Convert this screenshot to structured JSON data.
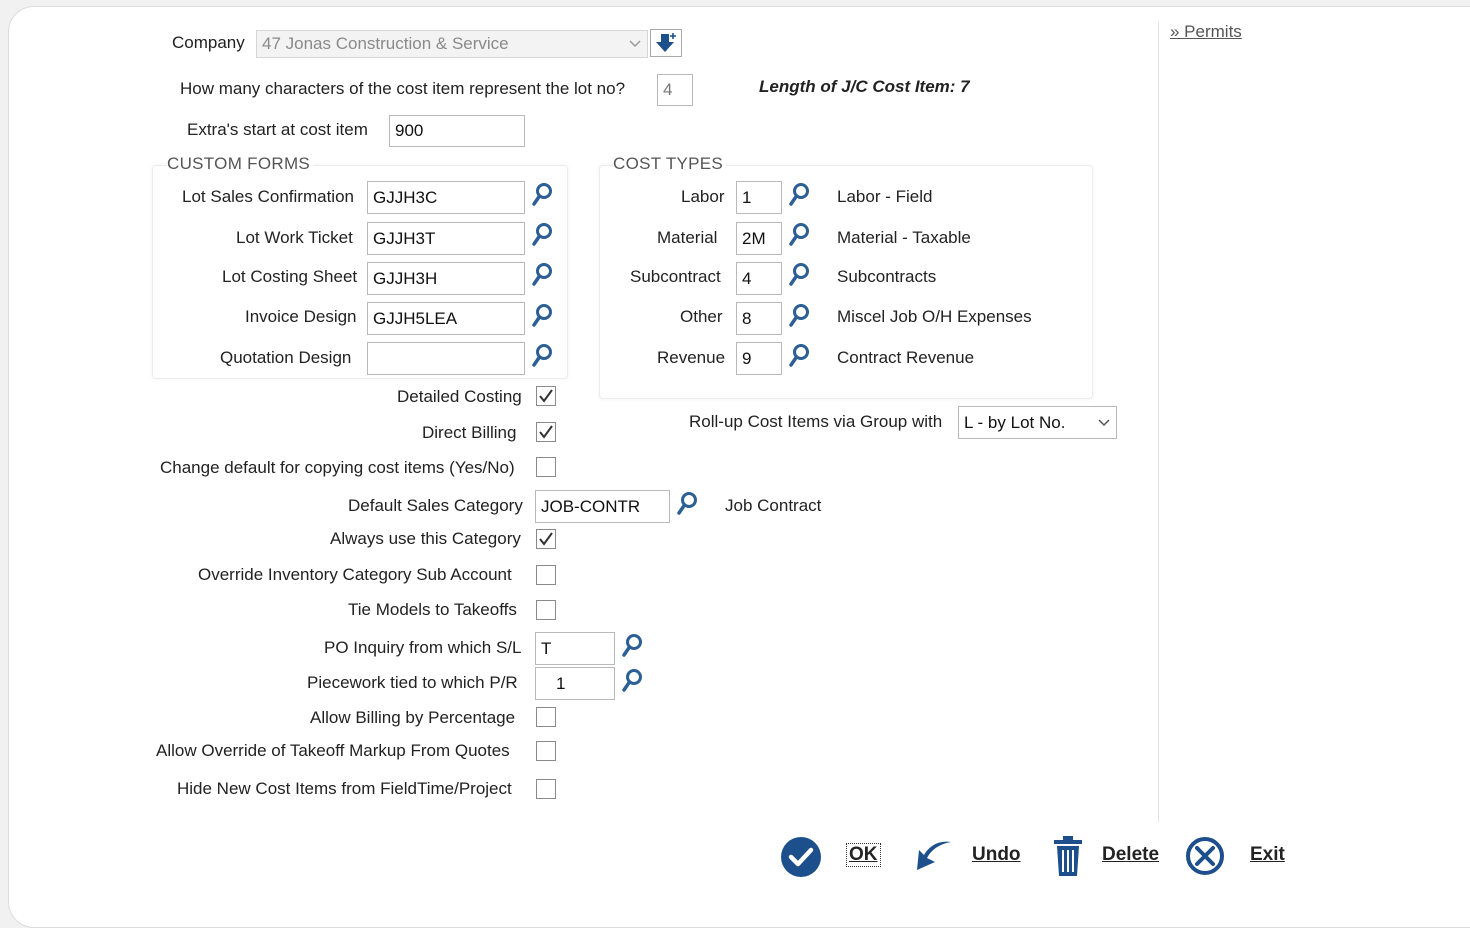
{
  "company": {
    "label": "Company",
    "value": "47 Jonas Construction & Service"
  },
  "lot_chars": {
    "label": "How many characters of the cost item represent the lot no?",
    "value": "4"
  },
  "length_note": "Length of J/C Cost Item: 7",
  "extras": {
    "label": "Extra's start at cost item",
    "value": "900"
  },
  "side_link": "» Permits",
  "custom_forms": {
    "title": "CUSTOM FORMS",
    "rows": [
      {
        "label": "Lot Sales Confirmation",
        "value": "GJJH3C"
      },
      {
        "label": "Lot Work Ticket",
        "value": "GJJH3T"
      },
      {
        "label": "Lot Costing Sheet",
        "value": "GJJH3H"
      },
      {
        "label": "Invoice Design",
        "value": "GJJH5LEA"
      },
      {
        "label": "Quotation Design",
        "value": ""
      }
    ]
  },
  "cost_types": {
    "title": "COST TYPES",
    "rows": [
      {
        "label": "Labor",
        "code": "1",
        "desc": "Labor - Field"
      },
      {
        "label": "Material",
        "code": "2M",
        "desc": "Material - Taxable"
      },
      {
        "label": "Subcontract",
        "code": "4",
        "desc": "Subcontracts"
      },
      {
        "label": "Other",
        "code": "8",
        "desc": "Miscel Job O/H Expenses"
      },
      {
        "label": "Revenue",
        "code": "9",
        "desc": "Contract Revenue"
      }
    ]
  },
  "rollup": {
    "label": "Roll-up Cost Items via Group with",
    "value": "L - by Lot No."
  },
  "checks": {
    "detailed_costing": {
      "label": "Detailed Costing",
      "checked": true
    },
    "direct_billing": {
      "label": "Direct Billing",
      "checked": true
    },
    "change_default": {
      "label": "Change default for copying cost items (Yes/No)",
      "checked": false
    },
    "always_use": {
      "label": "Always use this Category",
      "checked": true
    },
    "override_inventory": {
      "label": "Override Inventory Category Sub Account",
      "checked": false
    },
    "tie_models": {
      "label": "Tie Models to Takeoffs",
      "checked": false
    },
    "allow_billing_pct": {
      "label": "Allow Billing by Percentage",
      "checked": false
    },
    "allow_override_markup": {
      "label": "Allow Override of Takeoff Markup From Quotes",
      "checked": false
    },
    "hide_new_cost": {
      "label": "Hide New Cost Items from FieldTime/Project",
      "checked": false
    }
  },
  "sales_category": {
    "label": "Default Sales Category",
    "value": "JOB-CONTR",
    "desc": "Job Contract"
  },
  "po_inquiry": {
    "label": "PO Inquiry from which S/L",
    "value": "T"
  },
  "piecework": {
    "label": "Piecework tied to which P/R",
    "value": "1"
  },
  "buttons": {
    "ok": "OK",
    "undo": "Undo",
    "delete": "Delete",
    "exit": "Exit"
  },
  "colors": {
    "accent": "#1c4f8c",
    "magnifier": "#2b5f95"
  }
}
